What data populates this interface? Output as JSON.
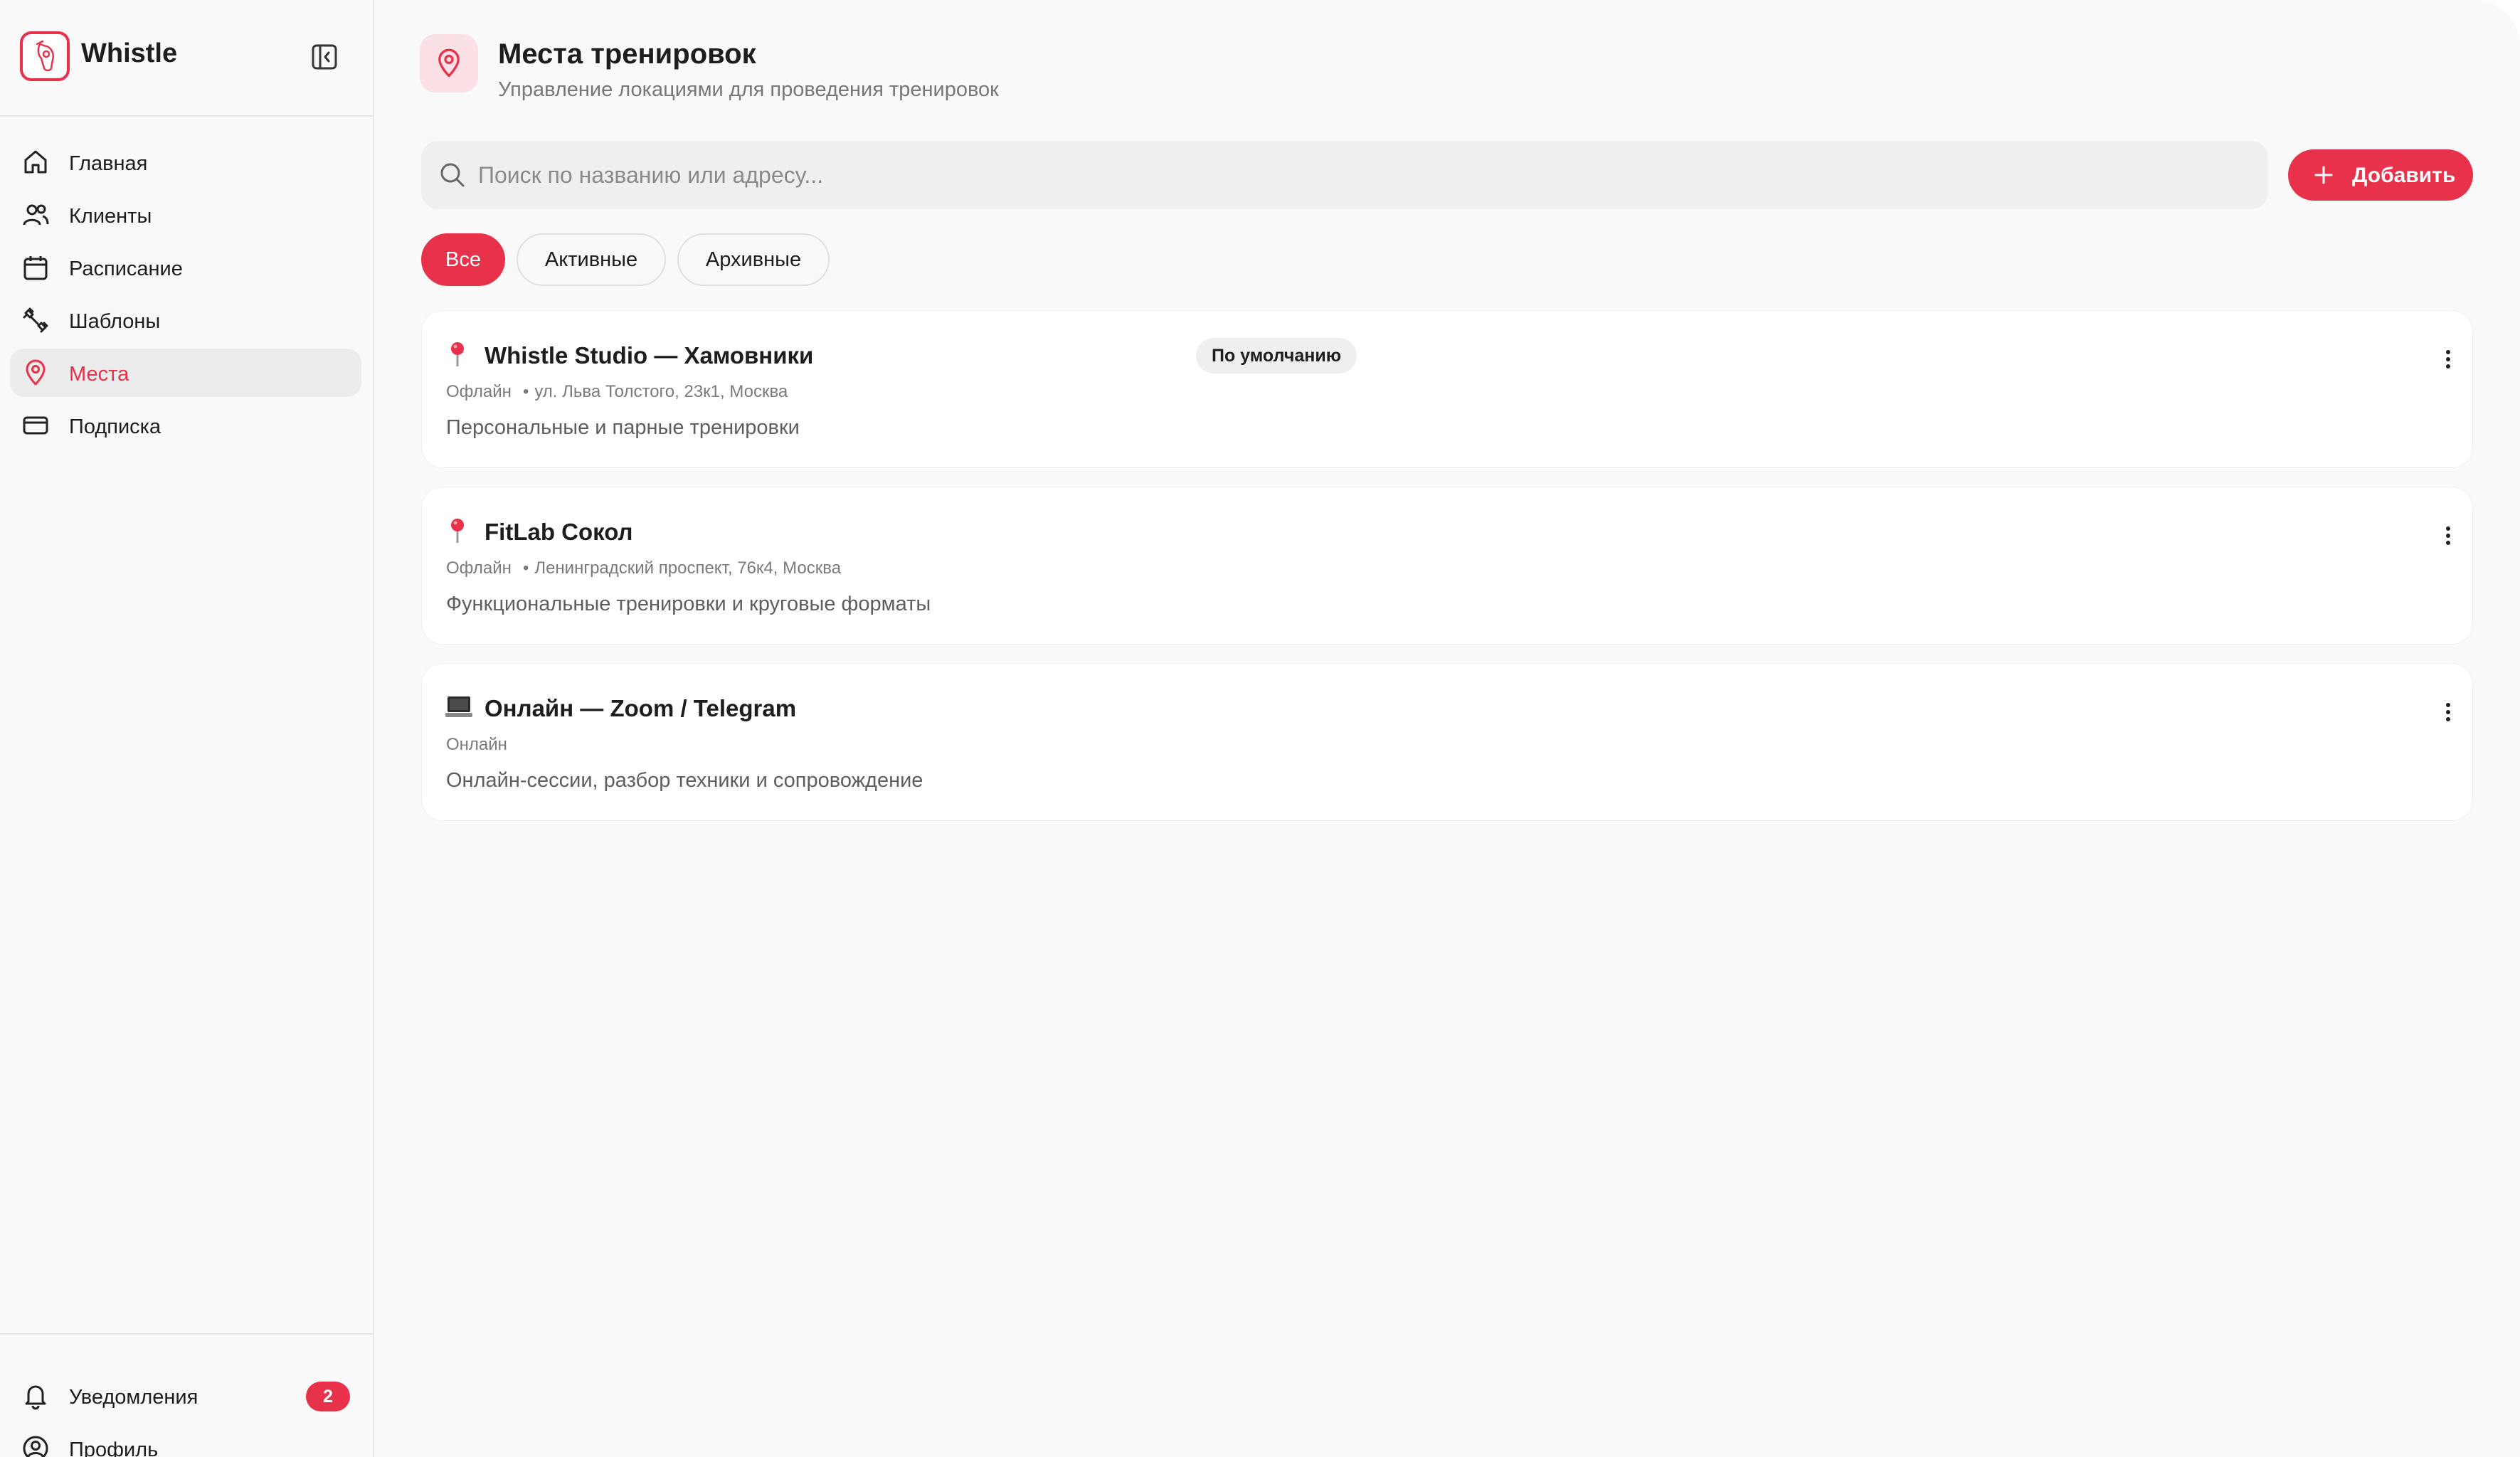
{
  "app": {
    "name": "Whistle"
  },
  "sidebar": {
    "items": [
      {
        "label": "Главная",
        "icon": "home-icon",
        "active": false
      },
      {
        "label": "Клиенты",
        "icon": "users-icon",
        "active": false
      },
      {
        "label": "Расписание",
        "icon": "calendar-icon",
        "active": false
      },
      {
        "label": "Шаблоны",
        "icon": "dumbbell-icon",
        "active": false
      },
      {
        "label": "Места",
        "icon": "map-pin-icon",
        "active": true
      },
      {
        "label": "Подписка",
        "icon": "credit-card-icon",
        "active": false
      }
    ],
    "footer": {
      "notifications_label": "Уведомления",
      "notifications_count": "2",
      "profile_label": "Профиль"
    }
  },
  "header": {
    "title": "Места тренировок",
    "subtitle": "Управление локациями для проведения тренировок"
  },
  "search": {
    "placeholder": "Поиск по названию или адресу...",
    "value": ""
  },
  "add_button": {
    "label": "Добавить"
  },
  "filters": [
    {
      "label": "Все",
      "active": true
    },
    {
      "label": "Активные",
      "active": false
    },
    {
      "label": "Архивные",
      "active": false
    }
  ],
  "locations": [
    {
      "icon": "pushpin-icon",
      "name": "Whistle Studio — Хамовники",
      "tag": "По умолчанию",
      "type": "Офлайн",
      "address": "ул. Льва Толстого, 23к1, Москва",
      "description": "Персональные и парные тренировки"
    },
    {
      "icon": "pushpin-icon",
      "name": "FitLab Сокол",
      "tag": "",
      "type": "Офлайн",
      "address": "Ленинградский проспект, 76к4, Москва",
      "description": "Функциональные тренировки и круговые форматы"
    },
    {
      "icon": "laptop-icon",
      "name": "Онлайн — Zoom / Telegram",
      "tag": "",
      "type": "Онлайн",
      "address": "",
      "description": "Онлайн-сессии, разбор техники и сопровождение"
    }
  ],
  "colors": {
    "accent": "#e8314b",
    "accent_soft": "#fbe1e5",
    "background": "#f9f9f9"
  }
}
